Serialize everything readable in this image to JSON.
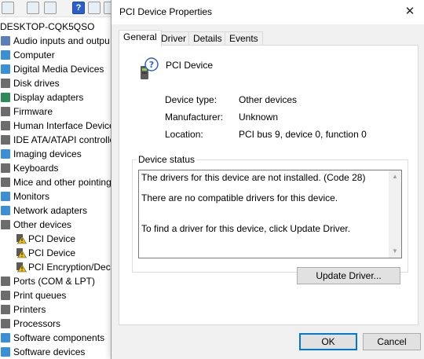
{
  "device_manager": {
    "computer_name": "DESKTOP-CQK5QSO",
    "categories": [
      {
        "label": "Audio inputs and outpu",
        "icon": "speaker-icon",
        "color": "#5a7fb8"
      },
      {
        "label": "Computer",
        "icon": "computer-icon",
        "color": "#3b8fd6"
      },
      {
        "label": "Digital Media Devices",
        "icon": "media-device-icon",
        "color": "#3b8fd6"
      },
      {
        "label": "Disk drives",
        "icon": "disk-drive-icon",
        "color": "#6c6c6c"
      },
      {
        "label": "Display adapters",
        "icon": "display-adapter-icon",
        "color": "#2e8b57"
      },
      {
        "label": "Firmware",
        "icon": "firmware-icon",
        "color": "#6c6c6c"
      },
      {
        "label": "Human Interface Device",
        "icon": "hid-icon",
        "color": "#6c6c6c"
      },
      {
        "label": "IDE ATA/ATAPI controlle",
        "icon": "ide-controller-icon",
        "color": "#6c6c6c"
      },
      {
        "label": "Imaging devices",
        "icon": "camera-icon",
        "color": "#3b8fd6"
      },
      {
        "label": "Keyboards",
        "icon": "keyboard-icon",
        "color": "#6c6c6c"
      },
      {
        "label": "Mice and other pointing",
        "icon": "mouse-icon",
        "color": "#6c6c6c"
      },
      {
        "label": "Monitors",
        "icon": "monitor-icon",
        "color": "#3b8fd6"
      },
      {
        "label": "Network adapters",
        "icon": "network-adapter-icon",
        "color": "#3b8fd6"
      },
      {
        "label": "Other devices",
        "icon": "unknown-device-icon",
        "color": "#6c6c6c"
      }
    ],
    "other_devices": [
      {
        "label": "PCI Device",
        "icon": "warning-icon"
      },
      {
        "label": "PCI Device",
        "icon": "warning-icon"
      },
      {
        "label": "PCI Encryption/Decr",
        "icon": "warning-icon"
      }
    ],
    "categories_after": [
      {
        "label": "Ports (COM & LPT)",
        "icon": "port-icon",
        "color": "#6c6c6c"
      },
      {
        "label": "Print queues",
        "icon": "print-queue-icon",
        "color": "#6c6c6c"
      },
      {
        "label": "Printers",
        "icon": "printer-icon",
        "color": "#6c6c6c"
      },
      {
        "label": "Processors",
        "icon": "processor-icon",
        "color": "#6c6c6c"
      },
      {
        "label": "Software components",
        "icon": "software-component-icon",
        "color": "#3b8fd6"
      },
      {
        "label": "Software devices",
        "icon": "software-device-icon",
        "color": "#3b8fd6"
      }
    ]
  },
  "dialog": {
    "title": "PCI Device Properties",
    "close_glyph": "✕",
    "tabs": [
      "General",
      "Driver",
      "Details",
      "Events"
    ],
    "active_tab": "General",
    "device_name": "PCI Device",
    "properties": {
      "device_type_label": "Device type:",
      "device_type_value": "Other devices",
      "manufacturer_label": "Manufacturer:",
      "manufacturer_value": "Unknown",
      "location_label": "Location:",
      "location_value": "PCI bus 9, device 0, function 0"
    },
    "status_group_title": "Device status",
    "status_lines": {
      "line1": "The drivers for this device are not installed. (Code 28)",
      "line2": "There are no compatible drivers for this device.",
      "line3": "To find a driver for this device, click Update Driver."
    },
    "update_driver_label": "Update Driver...",
    "ok_label": "OK",
    "cancel_label": "Cancel"
  },
  "colors": {
    "default_button_border": "#0078d7",
    "warning_yellow": "#f2c200"
  }
}
